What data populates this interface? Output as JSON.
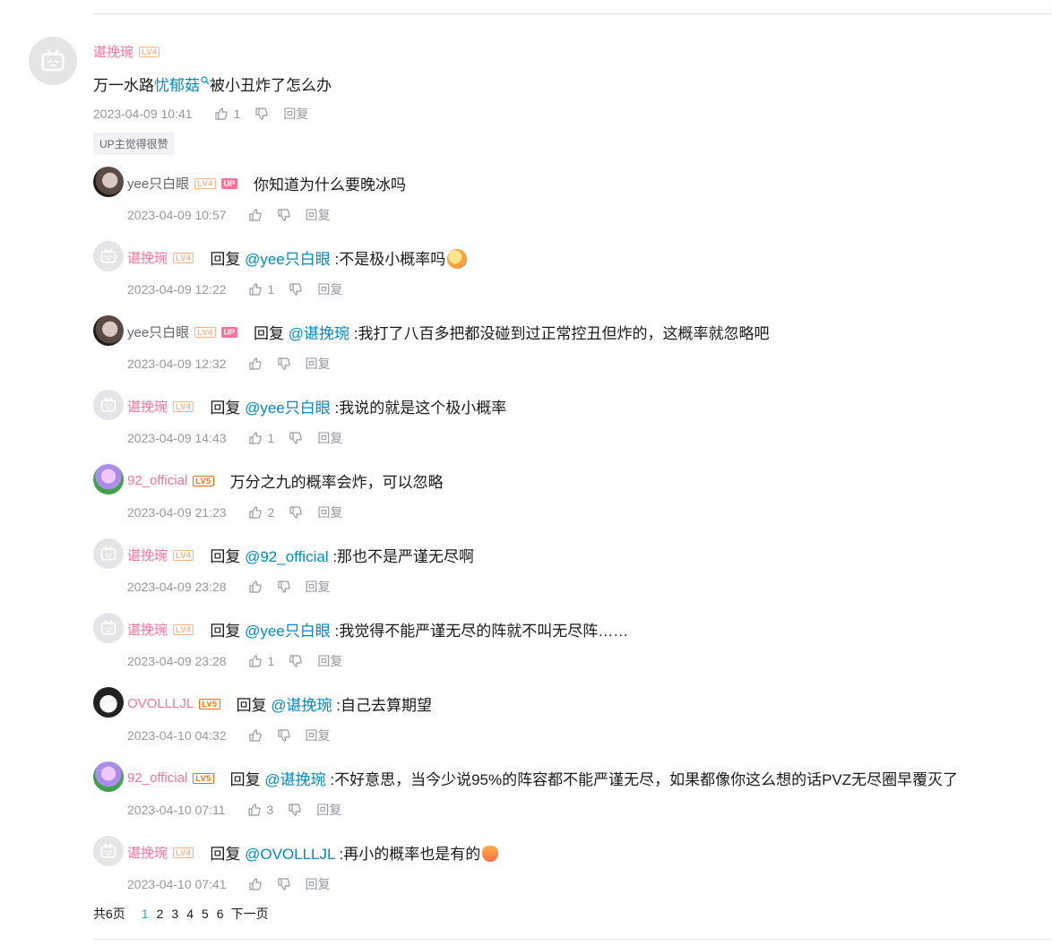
{
  "main_comment": {
    "user": "谌挽琬",
    "level": "LV4",
    "text_before": "万一水路",
    "topic": "忧郁菇",
    "text_after": "被小丑炸了怎么办",
    "time": "2023-04-09 10:41",
    "likes": "1",
    "reply_label": "回复",
    "up_like_tag": "UP主觉得很赞"
  },
  "replies": [
    {
      "user": "yee只白眼",
      "level": "LV4",
      "up": "UP",
      "reply_prefix": "",
      "at": "",
      "text": "你知道为什么要晚冰吗",
      "time": "2023-04-09 10:57",
      "likes": "",
      "avatar": "yee",
      "name_color": "normal",
      "emoji": ""
    },
    {
      "user": "谌挽琬",
      "level": "LV4",
      "up": "",
      "reply_prefix": "回复",
      "at": "@yee只白眼",
      "text": ":不是极小概率吗",
      "time": "2023-04-09 12:22",
      "likes": "1",
      "avatar": "default",
      "name_color": "pink",
      "emoji": "big"
    },
    {
      "user": "yee只白眼",
      "level": "LV4",
      "up": "UP",
      "reply_prefix": "回复",
      "at": "@谌挽琬",
      "text": ":我打了八百多把都没碰到过正常控丑但炸的，这概率就忽略吧",
      "time": "2023-04-09 12:32",
      "likes": "",
      "avatar": "yee",
      "name_color": "normal",
      "emoji": ""
    },
    {
      "user": "谌挽琬",
      "level": "LV4",
      "up": "",
      "reply_prefix": "回复",
      "at": "@yee只白眼",
      "text": ":我说的就是这个极小概率",
      "time": "2023-04-09 14:43",
      "likes": "1",
      "avatar": "default",
      "name_color": "pink",
      "emoji": ""
    },
    {
      "user": "92_official",
      "level": "LV5",
      "up": "",
      "reply_prefix": "",
      "at": "",
      "text": "万分之九的概率会炸，可以忽略",
      "time": "2023-04-09 21:23",
      "likes": "2",
      "avatar": "92",
      "name_color": "pink",
      "emoji": ""
    },
    {
      "user": "谌挽琬",
      "level": "LV4",
      "up": "",
      "reply_prefix": "回复",
      "at": "@92_official",
      "text": ":那也不是严谨无尽啊",
      "time": "2023-04-09 23:28",
      "likes": "",
      "avatar": "default",
      "name_color": "pink",
      "emoji": ""
    },
    {
      "user": "谌挽琬",
      "level": "LV4",
      "up": "",
      "reply_prefix": "回复",
      "at": "@yee只白眼",
      "text": ":我觉得不能严谨无尽的阵就不叫无尽阵……",
      "time": "2023-04-09 23:28",
      "likes": "1",
      "avatar": "default",
      "name_color": "pink",
      "emoji": ""
    },
    {
      "user": "OVOLLLJL",
      "level": "LV5",
      "up": "",
      "reply_prefix": "回复",
      "at": "@谌挽琬",
      "text": ":自己去算期望",
      "time": "2023-04-10 04:32",
      "likes": "",
      "avatar": "ovo",
      "name_color": "pink",
      "emoji": ""
    },
    {
      "user": "92_official",
      "level": "LV5",
      "up": "",
      "reply_prefix": "回复",
      "at": "@谌挽琬",
      "text": ":不好意思，当今少说95%的阵容都不能严谨无尽，如果都像你这么想的话PVZ无尽圈早覆灭了",
      "time": "2023-04-10 07:11",
      "likes": "3",
      "avatar": "92",
      "name_color": "pink",
      "emoji": ""
    },
    {
      "user": "谌挽琬",
      "level": "LV4",
      "up": "",
      "reply_prefix": "回复",
      "at": "@OVOLLLJL",
      "text": ":再小的概率也是有的",
      "time": "2023-04-10 07:41",
      "likes": "",
      "avatar": "default",
      "name_color": "pink",
      "emoji": "small"
    }
  ],
  "reply_label": "回复",
  "pager": {
    "total": "共6页",
    "pages": [
      "1",
      "2",
      "3",
      "4",
      "5",
      "6"
    ],
    "next": "下一页"
  },
  "colors": {
    "pink": "#fb7299",
    "link": "#008ac5",
    "meta": "#9499a0",
    "pager_active": "#00aeec"
  }
}
